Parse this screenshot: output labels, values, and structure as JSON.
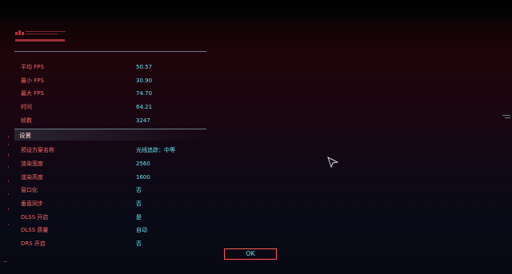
{
  "stats": [
    {
      "label": "平均 FPS",
      "value": "50.57"
    },
    {
      "label": "最小 FPS",
      "value": "30.90"
    },
    {
      "label": "最大 FPS",
      "value": "74.70"
    },
    {
      "label": "时间",
      "value": "64.21"
    },
    {
      "label": "帧数",
      "value": "3247"
    }
  ],
  "settings_header": "设置",
  "settings": [
    {
      "label": "预设方案名称",
      "value": "光线追踪：中等"
    },
    {
      "label": "渲染宽度",
      "value": "2560"
    },
    {
      "label": "渲染高度",
      "value": "1600"
    },
    {
      "label": "窗口化",
      "value": "否"
    },
    {
      "label": "垂直同步",
      "value": "否"
    },
    {
      "label": "DLSS 开启",
      "value": "是"
    },
    {
      "label": "DLSS 质量",
      "value": "自动"
    },
    {
      "label": "DRS 开启",
      "value": "否"
    }
  ],
  "ok_button": "OK",
  "colors": {
    "label": "#ff6a62",
    "value": "#66e6f0",
    "accent": "#ff5a4f"
  }
}
